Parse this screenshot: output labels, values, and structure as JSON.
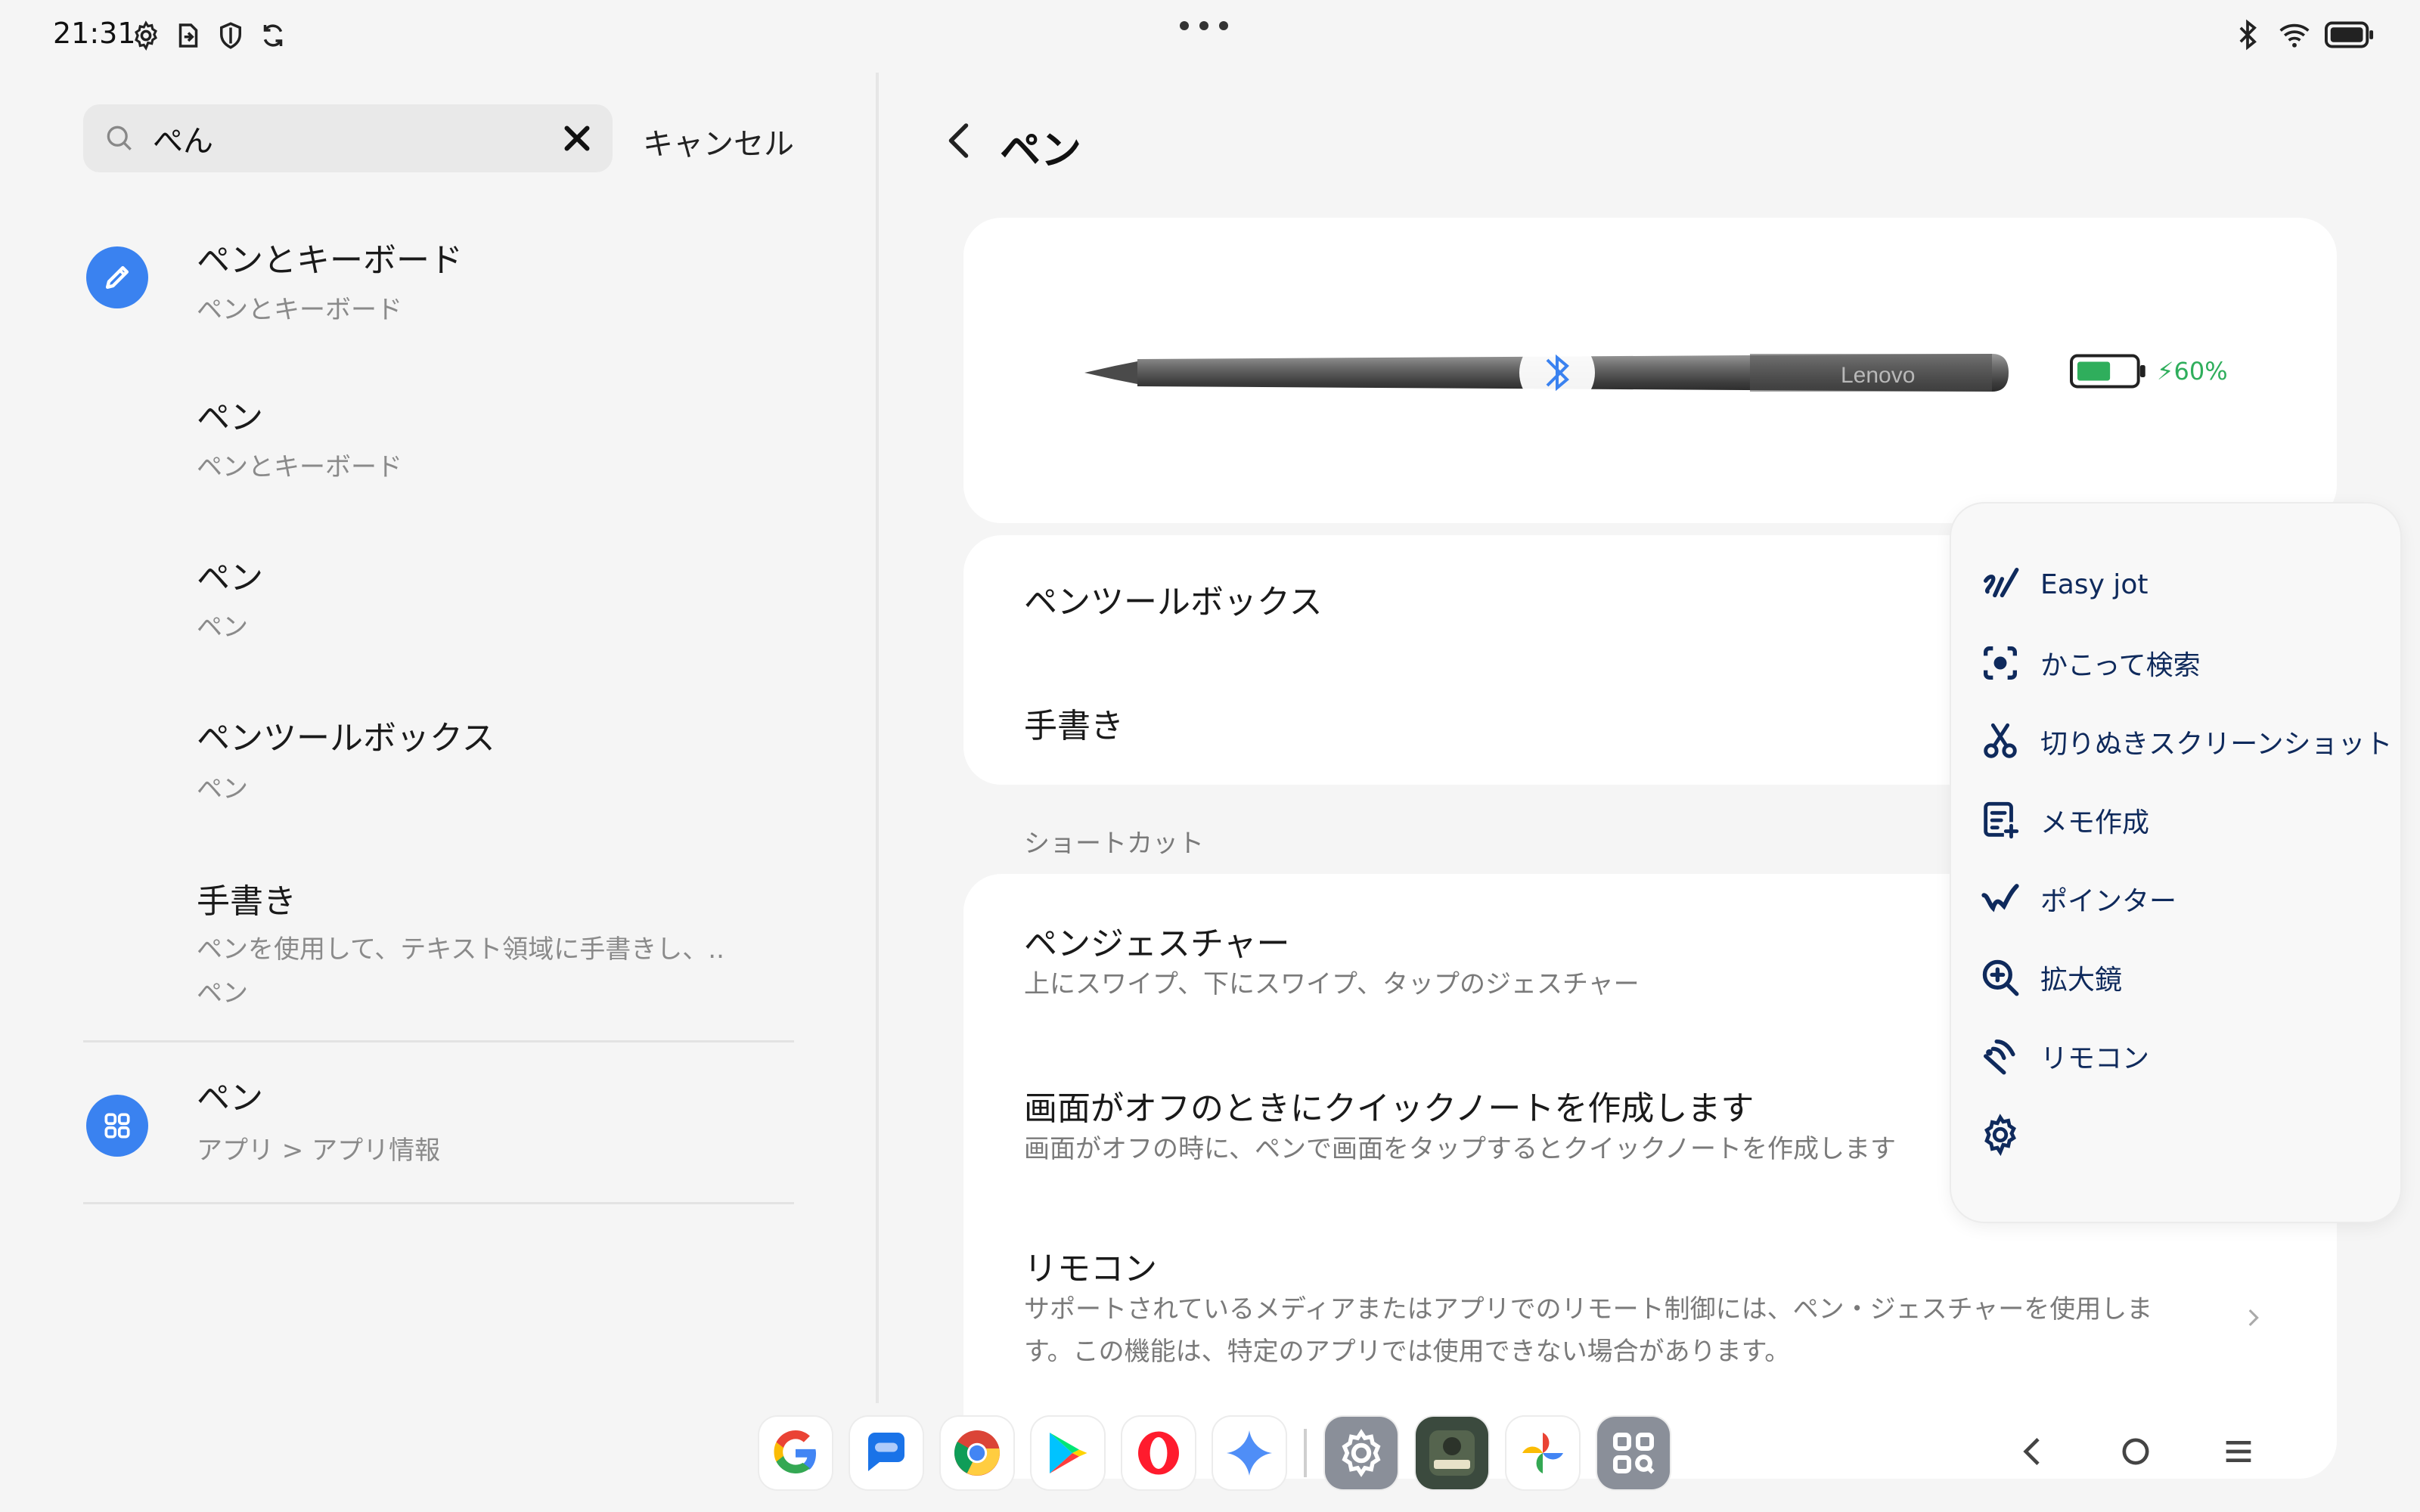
{
  "status_bar": {
    "time": "21:31",
    "left_icons": [
      "settings-gear-icon",
      "screen-cast-icon",
      "shield-icon",
      "sync-icon"
    ],
    "right_icons": [
      "bluetooth-icon",
      "wifi-icon",
      "battery-icon"
    ]
  },
  "search": {
    "value": "ぺん",
    "cancel_label": "キャンセル"
  },
  "results": [
    {
      "title": "ペンとキーボード",
      "subtitle": "ペンとキーボード",
      "icon": "pencil-icon"
    },
    {
      "title": "ペン",
      "subtitle": "ペンとキーボード"
    },
    {
      "title": "ペン",
      "subtitle": "ペン"
    },
    {
      "title": "ペンツールボックス",
      "subtitle": "ペン"
    },
    {
      "title": "手書き",
      "subtitle": "ペンを使用して、テキスト領域に手書きし、..",
      "subtitle2": "ペン"
    },
    {
      "title": "ペン",
      "subtitle": "アプリ > アプリ情報",
      "icon": "apps-grid-icon"
    }
  ],
  "page": {
    "title": "ペン",
    "pen_brand": "Lenovo",
    "pen_battery": "60%",
    "pen_battery_level": 0.6,
    "accent": "#3a82f0",
    "battery_color": "#2fae5c",
    "rows": {
      "toolbox": "ペンツールボックス",
      "handwriting": "手書き"
    },
    "section_shortcut": "ショートカット",
    "shortcuts": [
      {
        "title": "ペンジェスチャー",
        "subtitle": "上にスワイプ、下にスワイプ、タップのジェスチャー"
      },
      {
        "title": "画面がオフのときにクイックノートを作成します",
        "subtitle": "画面がオフの時に、ペンで画面をタップするとクイックノートを作成します"
      },
      {
        "title": "リモコン",
        "subtitle": "サポートされているメディアまたはアプリでのリモート制御には、ペン・ジェスチャーを使用しま",
        "subtitle2": "す。この機能は、特定のアプリでは使用できない場合があります。"
      }
    ]
  },
  "popup_menu": [
    {
      "label": "Easy jot",
      "icon": "easy-jot-icon"
    },
    {
      "label": "かこって検索",
      "icon": "circle-search-icon"
    },
    {
      "label": "切りぬきスクリーンショット",
      "icon": "scissors-icon"
    },
    {
      "label": "メモ作成",
      "icon": "note-add-icon"
    },
    {
      "label": "ポインター",
      "icon": "pointer-icon"
    },
    {
      "label": "拡大鏡",
      "icon": "magnifier-icon"
    },
    {
      "label": "リモコン",
      "icon": "remote-icon"
    },
    {
      "label": "",
      "icon": "settings-icon"
    }
  ],
  "dock": [
    "google-icon",
    "messages-icon",
    "chrome-icon",
    "play-store-icon",
    "opera-icon",
    "gemini-icon",
    "settings-app-icon",
    "call-of-duty-icon",
    "photos-icon",
    "app-grid-search-icon"
  ],
  "nav": [
    "back-icon",
    "home-icon",
    "menu-icon"
  ]
}
